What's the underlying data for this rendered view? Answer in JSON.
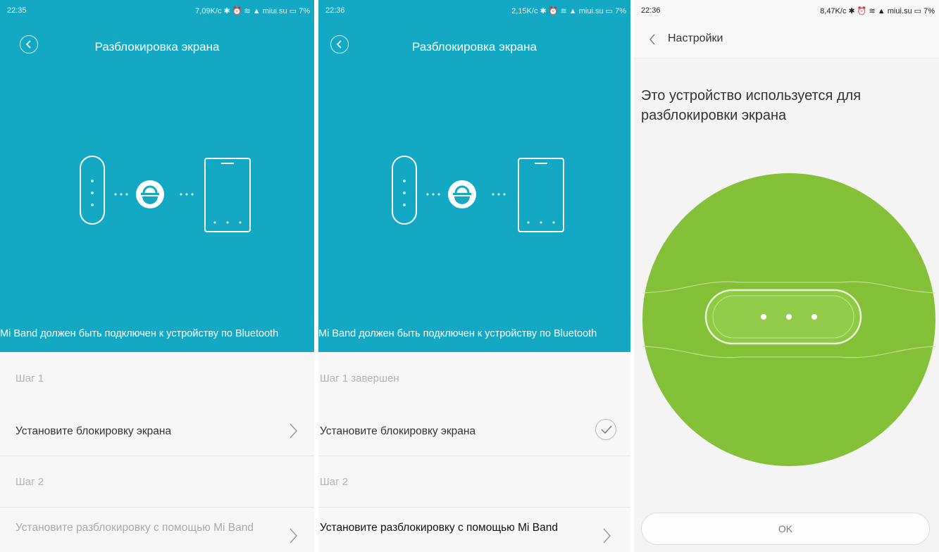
{
  "panel1": {
    "status": {
      "time": "22:35",
      "info": "7,09K/c ✱ ⏰ ≋ ▲ miui.su ▭ 7%"
    },
    "title": "Разблокировка экрана",
    "bluetooth_note": "Mi Band должен быть подключен к устройству по Bluetooth",
    "step1_label": "Шаг 1",
    "step1_action": "Установите блокировку экрана",
    "step2_label": "Шаг 2",
    "step2_action": "Установите разблокировку с помощью Mi Band"
  },
  "panel2": {
    "status": {
      "time": "22:36",
      "info": "2,15K/c ✱ ⏰ ≋ ▲ miui.su ▭ 7%"
    },
    "title": "Разблокировка экрана",
    "bluetooth_note": "Mi Band должен быть подключен к устройству по Bluetooth",
    "step1_label": "Шаг 1 завершен",
    "step1_action": "Установите блокировку экрана",
    "step2_label": "Шаг 2",
    "step2_action": "Установите разблокировку с помощью Mi Band"
  },
  "panel3": {
    "status": {
      "time": "22:36",
      "info": "8,47K/c ✱ ⏰ ≋ ▲ miui.su ▭ 7%"
    },
    "back_title": "Настройки",
    "heading": "Это устройство используется для разблокировки экрана",
    "ok_label": "OK"
  },
  "colors": {
    "teal": "#13a8c4",
    "green": "#84c138",
    "text": "#333333",
    "muted": "#b3b3b3"
  },
  "icons": [
    "back-icon",
    "band-icon",
    "unlock-icon",
    "phone-icon",
    "chevron-right-icon",
    "checkmark-icon",
    "mi-band-illustration"
  ]
}
